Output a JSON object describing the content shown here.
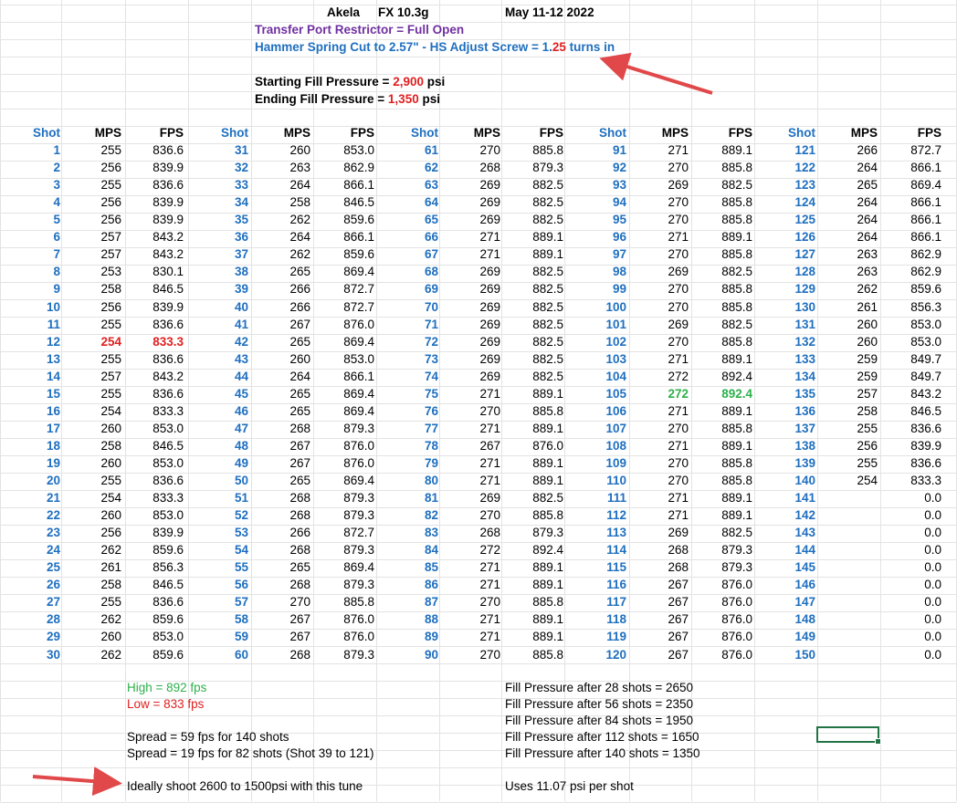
{
  "header": {
    "rifle": "Akela",
    "pellet": "FX 10.3g",
    "date": "May 11-12 2022",
    "transfer_port": "Transfer Port Restrictor = Full Open",
    "hammer_prefix": "Hammer Spring Cut to 2.57\" - HS Adjust Screw = 1.",
    "hammer_highlight": "25",
    "hammer_suffix": " turns in",
    "start_fill_label": "Starting Fill Pressure = ",
    "start_fill_value": "2,900",
    "start_fill_unit": " psi",
    "end_fill_label": "Ending  Fill Pressure = ",
    "end_fill_value": "1,350",
    "end_fill_unit": " psi"
  },
  "columns": {
    "shot": "Shot",
    "mps": "MPS",
    "fps": "FPS"
  },
  "shots": [
    [
      1,
      255,
      "836.6"
    ],
    [
      2,
      256,
      "839.9"
    ],
    [
      3,
      255,
      "836.6"
    ],
    [
      4,
      256,
      "839.9"
    ],
    [
      5,
      256,
      "839.9"
    ],
    [
      6,
      257,
      "843.2"
    ],
    [
      7,
      257,
      "843.2"
    ],
    [
      8,
      253,
      "830.1"
    ],
    [
      9,
      258,
      "846.5"
    ],
    [
      10,
      256,
      "839.9"
    ],
    [
      11,
      255,
      "836.6"
    ],
    [
      12,
      254,
      "833.3"
    ],
    [
      13,
      255,
      "836.6"
    ],
    [
      14,
      257,
      "843.2"
    ],
    [
      15,
      255,
      "836.6"
    ],
    [
      16,
      254,
      "833.3"
    ],
    [
      17,
      260,
      "853.0"
    ],
    [
      18,
      258,
      "846.5"
    ],
    [
      19,
      260,
      "853.0"
    ],
    [
      20,
      255,
      "836.6"
    ],
    [
      21,
      254,
      "833.3"
    ],
    [
      22,
      260,
      "853.0"
    ],
    [
      23,
      256,
      "839.9"
    ],
    [
      24,
      262,
      "859.6"
    ],
    [
      25,
      261,
      "856.3"
    ],
    [
      26,
      258,
      "846.5"
    ],
    [
      27,
      255,
      "836.6"
    ],
    [
      28,
      262,
      "859.6"
    ],
    [
      29,
      260,
      "853.0"
    ],
    [
      30,
      262,
      "859.6"
    ],
    [
      31,
      260,
      "853.0"
    ],
    [
      32,
      263,
      "862.9"
    ],
    [
      33,
      264,
      "866.1"
    ],
    [
      34,
      258,
      "846.5"
    ],
    [
      35,
      262,
      "859.6"
    ],
    [
      36,
      264,
      "866.1"
    ],
    [
      37,
      262,
      "859.6"
    ],
    [
      38,
      265,
      "869.4"
    ],
    [
      39,
      266,
      "872.7"
    ],
    [
      40,
      266,
      "872.7"
    ],
    [
      41,
      267,
      "876.0"
    ],
    [
      42,
      265,
      "869.4"
    ],
    [
      43,
      260,
      "853.0"
    ],
    [
      44,
      264,
      "866.1"
    ],
    [
      45,
      265,
      "869.4"
    ],
    [
      46,
      265,
      "869.4"
    ],
    [
      47,
      268,
      "879.3"
    ],
    [
      48,
      267,
      "876.0"
    ],
    [
      49,
      267,
      "876.0"
    ],
    [
      50,
      265,
      "869.4"
    ],
    [
      51,
      268,
      "879.3"
    ],
    [
      52,
      268,
      "879.3"
    ],
    [
      53,
      266,
      "872.7"
    ],
    [
      54,
      268,
      "879.3"
    ],
    [
      55,
      265,
      "869.4"
    ],
    [
      56,
      268,
      "879.3"
    ],
    [
      57,
      270,
      "885.8"
    ],
    [
      58,
      267,
      "876.0"
    ],
    [
      59,
      267,
      "876.0"
    ],
    [
      60,
      268,
      "879.3"
    ],
    [
      61,
      270,
      "885.8"
    ],
    [
      62,
      268,
      "879.3"
    ],
    [
      63,
      269,
      "882.5"
    ],
    [
      64,
      269,
      "882.5"
    ],
    [
      65,
      269,
      "882.5"
    ],
    [
      66,
      271,
      "889.1"
    ],
    [
      67,
      271,
      "889.1"
    ],
    [
      68,
      269,
      "882.5"
    ],
    [
      69,
      269,
      "882.5"
    ],
    [
      70,
      269,
      "882.5"
    ],
    [
      71,
      269,
      "882.5"
    ],
    [
      72,
      269,
      "882.5"
    ],
    [
      73,
      269,
      "882.5"
    ],
    [
      74,
      269,
      "882.5"
    ],
    [
      75,
      271,
      "889.1"
    ],
    [
      76,
      270,
      "885.8"
    ],
    [
      77,
      271,
      "889.1"
    ],
    [
      78,
      267,
      "876.0"
    ],
    [
      79,
      271,
      "889.1"
    ],
    [
      80,
      271,
      "889.1"
    ],
    [
      81,
      269,
      "882.5"
    ],
    [
      82,
      270,
      "885.8"
    ],
    [
      83,
      268,
      "879.3"
    ],
    [
      84,
      272,
      "892.4"
    ],
    [
      85,
      271,
      "889.1"
    ],
    [
      86,
      271,
      "889.1"
    ],
    [
      87,
      270,
      "885.8"
    ],
    [
      88,
      271,
      "889.1"
    ],
    [
      89,
      271,
      "889.1"
    ],
    [
      90,
      270,
      "885.8"
    ],
    [
      91,
      271,
      "889.1"
    ],
    [
      92,
      270,
      "885.8"
    ],
    [
      93,
      269,
      "882.5"
    ],
    [
      94,
      270,
      "885.8"
    ],
    [
      95,
      270,
      "885.8"
    ],
    [
      96,
      271,
      "889.1"
    ],
    [
      97,
      270,
      "885.8"
    ],
    [
      98,
      269,
      "882.5"
    ],
    [
      99,
      270,
      "885.8"
    ],
    [
      100,
      270,
      "885.8"
    ],
    [
      101,
      269,
      "882.5"
    ],
    [
      102,
      270,
      "885.8"
    ],
    [
      103,
      271,
      "889.1"
    ],
    [
      104,
      272,
      "892.4"
    ],
    [
      105,
      272,
      "892.4"
    ],
    [
      106,
      271,
      "889.1"
    ],
    [
      107,
      270,
      "885.8"
    ],
    [
      108,
      271,
      "889.1"
    ],
    [
      109,
      270,
      "885.8"
    ],
    [
      110,
      270,
      "885.8"
    ],
    [
      111,
      271,
      "889.1"
    ],
    [
      112,
      271,
      "889.1"
    ],
    [
      113,
      269,
      "882.5"
    ],
    [
      114,
      268,
      "879.3"
    ],
    [
      115,
      268,
      "879.3"
    ],
    [
      116,
      267,
      "876.0"
    ],
    [
      117,
      267,
      "876.0"
    ],
    [
      118,
      267,
      "876.0"
    ],
    [
      119,
      267,
      "876.0"
    ],
    [
      120,
      267,
      "876.0"
    ],
    [
      121,
      266,
      "872.7"
    ],
    [
      122,
      264,
      "866.1"
    ],
    [
      123,
      265,
      "869.4"
    ],
    [
      124,
      264,
      "866.1"
    ],
    [
      125,
      264,
      "866.1"
    ],
    [
      126,
      264,
      "866.1"
    ],
    [
      127,
      263,
      "862.9"
    ],
    [
      128,
      263,
      "862.9"
    ],
    [
      129,
      262,
      "859.6"
    ],
    [
      130,
      261,
      "856.3"
    ],
    [
      131,
      260,
      "853.0"
    ],
    [
      132,
      260,
      "853.0"
    ],
    [
      133,
      259,
      "849.7"
    ],
    [
      134,
      259,
      "849.7"
    ],
    [
      135,
      257,
      "843.2"
    ],
    [
      136,
      258,
      "846.5"
    ],
    [
      137,
      255,
      "836.6"
    ],
    [
      138,
      256,
      "839.9"
    ],
    [
      139,
      255,
      "836.6"
    ],
    [
      140,
      254,
      "833.3"
    ],
    [
      141,
      "",
      "0.0"
    ],
    [
      142,
      "",
      "0.0"
    ],
    [
      143,
      "",
      "0.0"
    ],
    [
      144,
      "",
      "0.0"
    ],
    [
      145,
      "",
      "0.0"
    ],
    [
      146,
      "",
      "0.0"
    ],
    [
      147,
      "",
      "0.0"
    ],
    [
      148,
      "",
      "0.0"
    ],
    [
      149,
      "",
      "0.0"
    ],
    [
      150,
      "",
      "0.0"
    ]
  ],
  "highlight": {
    "low_shot": 12,
    "high_shot": 105,
    "low_color": "#e02020",
    "high_color": "#2db04b"
  },
  "summary": {
    "high": "High = 892 fps",
    "low": "Low = 833 fps",
    "spread1": "Spread = 59 fps for 140 shots",
    "spread2": "Spread = 19 fps for 82 shots (Shot 39 to 121)",
    "ideal": "Ideally shoot 2600 to 1500psi with this tune",
    "fill": [
      "Fill Pressure after 28 shots = 2650",
      "Fill Pressure after 56 shots = 2350",
      "Fill Pressure after 84 shots = 1950",
      "Fill Pressure after 112 shots = 1650",
      "Fill Pressure after 140 shots = 1350"
    ],
    "uses": "Uses 11.07 psi per shot"
  },
  "colors": {
    "shot_blue": "#1f6fbf",
    "purple": "#7030a0",
    "red": "#e02020",
    "green": "#2db04b",
    "arrow": "#e0484a"
  }
}
